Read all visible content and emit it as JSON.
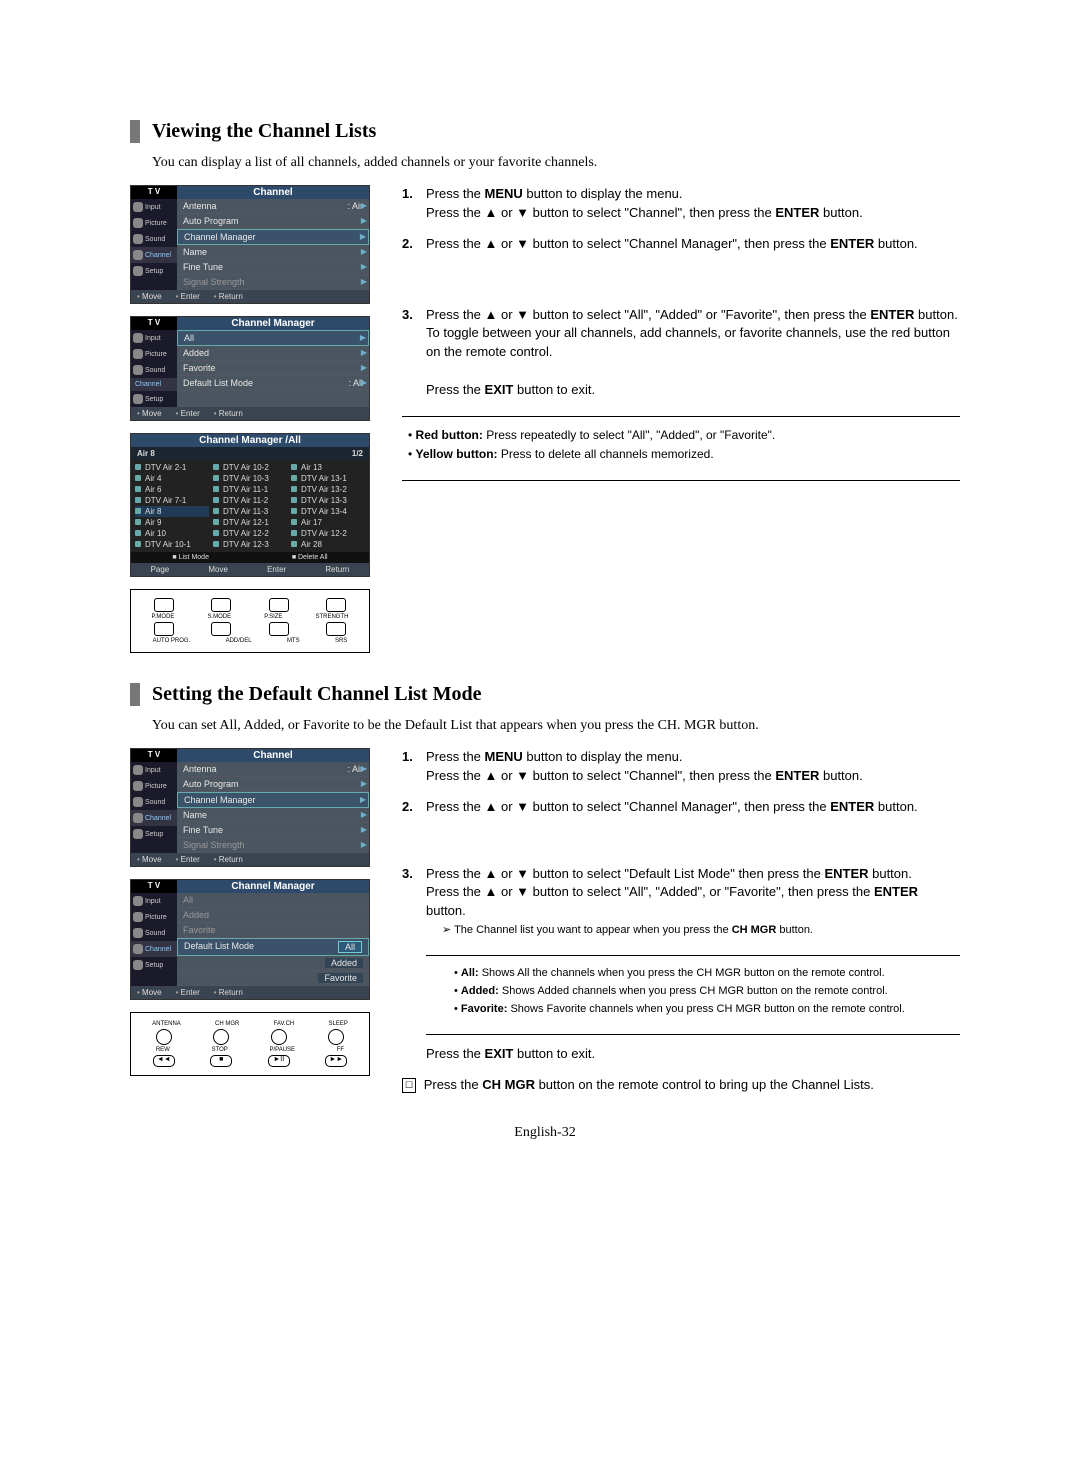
{
  "sectionA": {
    "title": "Viewing the Channel Lists",
    "subtitle": "You can display a list of all channels, added channels or your favorite channels."
  },
  "sectionB": {
    "title": "Setting the Default Channel List Mode",
    "subtitle": "You can set All, Added, or Favorite to be the Default List that appears when you press the CH. MGR button."
  },
  "osd": {
    "tv": "T V",
    "channel_title": "Channel",
    "chan_mgr_title": "Channel Manager",
    "side": {
      "input": "Input",
      "picture": "Picture",
      "sound": "Sound",
      "channel": "Channel",
      "setup": "Setup"
    },
    "menu1": {
      "antenna_label": "Antenna",
      "antenna_value": ": Air",
      "auto_program": "Auto Program",
      "channel_manager": "Channel Manager",
      "name": "Name",
      "fine_tune": "Fine Tune",
      "signal_strength": "Signal Strength"
    },
    "menu2": {
      "all": "All",
      "added": "Added",
      "favorite": "Favorite",
      "default_list_mode": "Default List Mode",
      "default_list_value": ": All",
      "val_all": "All",
      "val_added": "Added",
      "val_favorite": "Favorite"
    },
    "foot": {
      "move": "Move",
      "enter": "Enter",
      "return": "Return"
    }
  },
  "chgrid": {
    "title": "Channel Manager /All",
    "current": "Air 8",
    "page": "1/2",
    "col1": [
      "DTV Air 2-1",
      "Air 4",
      "Air 6",
      "DTV Air 7-1",
      "Air 8",
      "Air 9",
      "Air 10",
      "DTV Air 10-1"
    ],
    "col2": [
      "DTV Air 10-2",
      "DTV Air 10-3",
      "DTV Air 11-1",
      "DTV Air 11-2",
      "DTV Air 11-3",
      "DTV Air 12-1",
      "DTV Air 12-2",
      "DTV Air 12-3"
    ],
    "col3": [
      "Air 13",
      "DTV Air 13-1",
      "DTV Air 13-2",
      "DTV Air 13-3",
      "DTV Air 13-4",
      "Air 17",
      "DTV Air 12-2",
      "Air 28"
    ],
    "legend": {
      "list_mode": "List Mode",
      "delete_all": "Delete All"
    },
    "foot": {
      "page": "Page",
      "move": "Move",
      "enter": "Enter",
      "return": "Return"
    }
  },
  "remoteA": {
    "r1": [
      "P.MODE",
      "S.MODE",
      "P.SIZE",
      "STRENGTH"
    ],
    "r2": [
      "AUTO PROG.",
      "ADD/DEL",
      "MTS",
      "SRS"
    ]
  },
  "remoteB": {
    "r1": [
      "ANTENNA",
      "CH MGR",
      "FAV.CH",
      "SLEEP"
    ],
    "r2": [
      "REW",
      "STOP",
      "P/PAUSE",
      "FF"
    ]
  },
  "stepsA": {
    "s1a": "Press the ",
    "s1b": "MENU",
    "s1c": " button to display the menu.",
    "s1d": "Press the ▲ or ▼ button to select \"Channel\", then press the ",
    "s1e": "ENTER",
    "s1f": " button.",
    "s2a": "Press the ▲ or ▼ button to select \"Channel Manager\", then press the ",
    "s2b": "ENTER",
    "s2c": " button.",
    "s3a": "Press the ▲ or ▼ button to select \"All\", \"Added\" or \"Favorite\", then press the ",
    "s3b": "ENTER",
    "s3c": " button.",
    "s3d": "To toggle between your all channels, add channels, or favorite channels, use the red button on the remote control.",
    "s3e": "Press the ",
    "s3f": "EXIT",
    "s3g": " button to exit.",
    "note1a": "Red button:",
    "note1b": " Press repeatedly to select \"All\", \"Added\", or \"Favorite\".",
    "note2a": "Yellow button:",
    "note2b": " Press to delete all channels memorized."
  },
  "stepsB": {
    "s1a": "Press the ",
    "s1b": "MENU",
    "s1c": " button to display the menu.",
    "s1d": "Press the ▲ or ▼ button to select \"Channel\", then press the ",
    "s1e": "ENTER",
    "s1f": " button.",
    "s2a": "Press the ▲ or ▼ button to select \"Channel Manager\", then press the ",
    "s2b": "ENTER",
    "s2c": " button.",
    "s3a": "Press the ▲ or ▼ button to select \"Default List Mode\" then press the ",
    "s3b": "ENTER",
    "s3c": " button.",
    "s3d": "Press the ▲ or ▼ button to select \"All\", \"Added\", or \"Favorite\", then press the ",
    "s3e": "ENTER",
    "s3f": " button.",
    "s3g": "➢  The Channel list you want to appear when you press the ",
    "s3h": "CH MGR",
    "s3i": " button.",
    "n1a": "All:",
    "n1b": " Shows All the channels when you press the CH MGR button on the remote control.",
    "n2a": "Added:",
    "n2b": " Shows Added channels when you press CH MGR button on the remote control.",
    "n3a": "Favorite:",
    "n3b": " Shows Favorite channels when you press CH MGR button on the remote control.",
    "s3j": "Press the ",
    "s3k": "EXIT",
    "s3l": " button to exit.",
    "finalA": "Press the ",
    "finalB": "CH MGR",
    "finalC": " button on the remote control to bring up the Channel Lists."
  },
  "page_foot": "English-32"
}
